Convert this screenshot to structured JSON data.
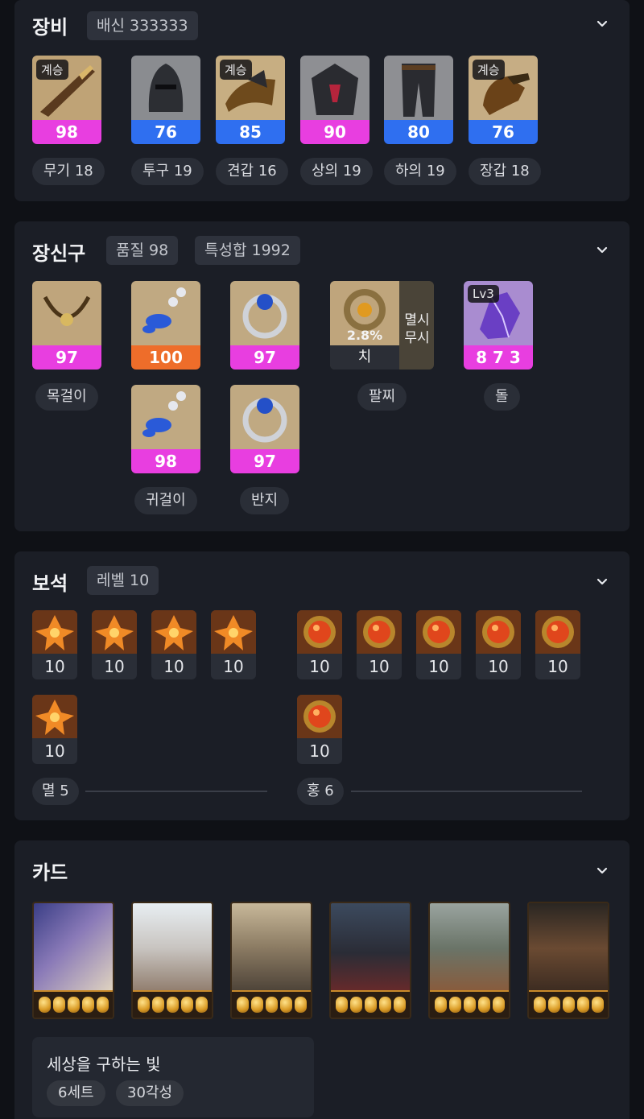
{
  "equipment": {
    "title": "장비",
    "badge": "배신 333333",
    "items": [
      {
        "quality": "98",
        "tag": "계승",
        "label": "무기 18",
        "color": "#e83ee0"
      },
      {
        "quality": "76",
        "tag": "",
        "label": "투구 19",
        "color": "#2f6ff0"
      },
      {
        "quality": "85",
        "tag": "계승",
        "label": "견갑 16",
        "color": "#2f6ff0"
      },
      {
        "quality": "90",
        "tag": "",
        "label": "상의 19",
        "color": "#e83ee0"
      },
      {
        "quality": "80",
        "tag": "",
        "label": "하의 19",
        "color": "#2f6ff0"
      },
      {
        "quality": "76",
        "tag": "계승",
        "label": "장갑 18",
        "color": "#2f6ff0"
      }
    ]
  },
  "accessories": {
    "title": "장신구",
    "badge_quality": "품질 98",
    "badge_stats": "특성합 1992",
    "necklace": {
      "quality": "97",
      "label": "목걸이"
    },
    "earrings": [
      {
        "quality": "100"
      },
      {
        "quality": "98"
      }
    ],
    "earring_label": "귀걸이",
    "rings": [
      {
        "quality": "97"
      },
      {
        "quality": "97"
      }
    ],
    "ring_label": "반지",
    "bracelet": {
      "percent": "2.8%",
      "stat": "치",
      "effect_line1": "멸시",
      "effect_line2": "무시",
      "label": "팔찌"
    },
    "stone": {
      "level": "Lv3",
      "value": "8 7 3",
      "label": "돌"
    }
  },
  "gems": {
    "title": "보석",
    "badge": "레벨 10",
    "left_levels": [
      "10",
      "10",
      "10",
      "10",
      "10"
    ],
    "right_levels": [
      "10",
      "10",
      "10",
      "10",
      "10",
      "10"
    ],
    "left_label": "멸 5",
    "right_label": "홍 6"
  },
  "cards": {
    "title": "카드",
    "set_name": "세상을 구하는 빛",
    "set_count": "6세트",
    "awakening": "30각성",
    "awakening_per_card": 5
  },
  "icons": {
    "collapse": "chevron-down-icon"
  }
}
